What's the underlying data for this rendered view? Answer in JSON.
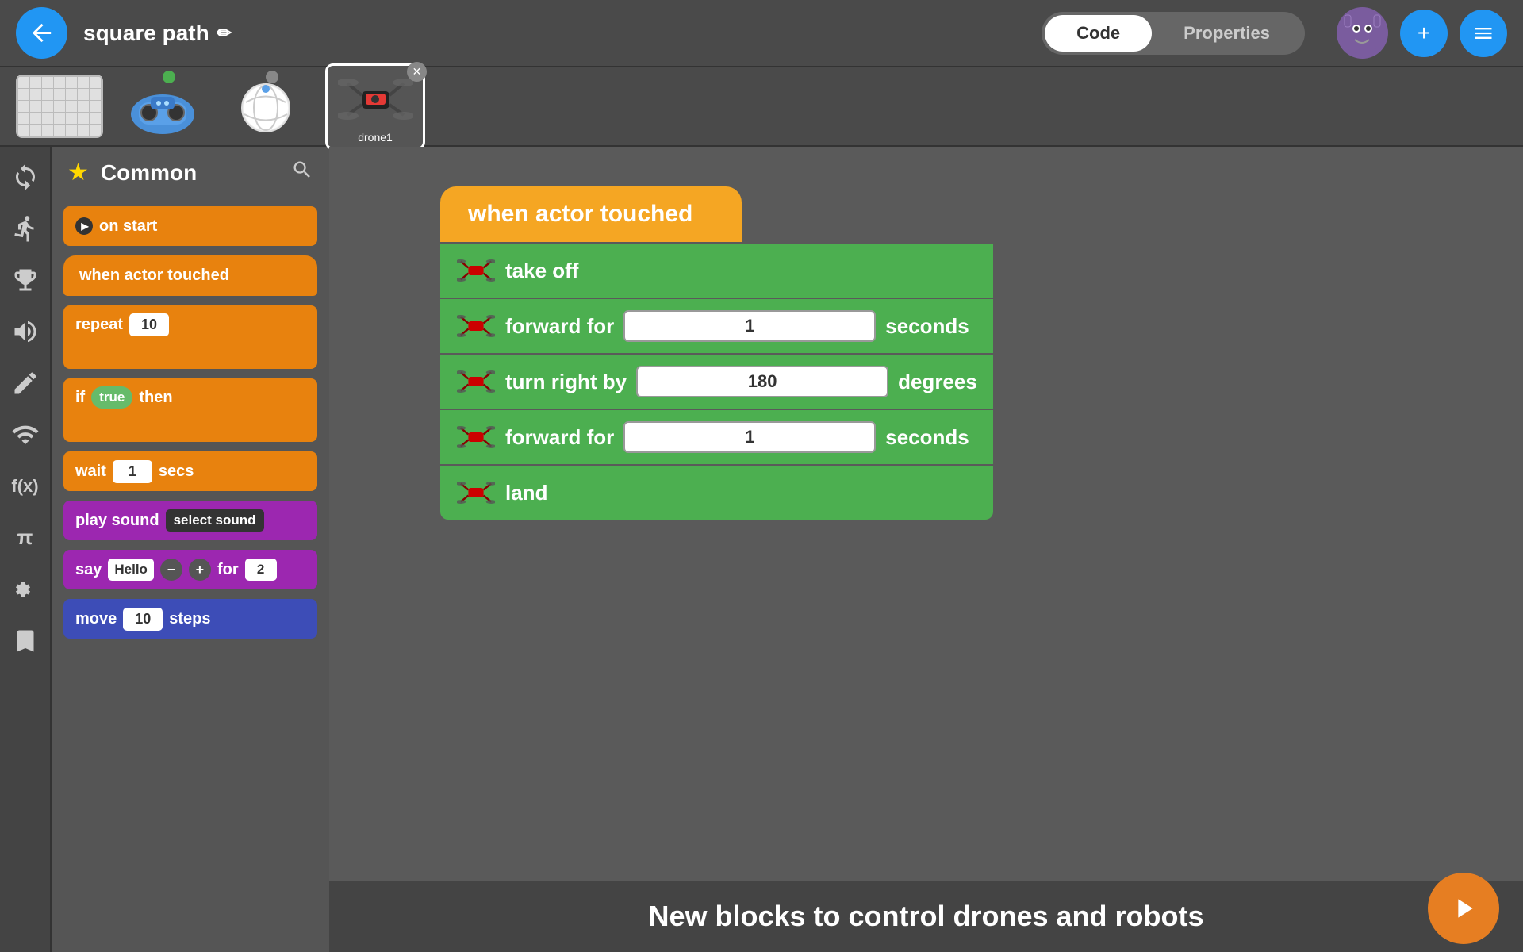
{
  "topbar": {
    "back_label": "←",
    "project_title": "square path",
    "pencil": "✏",
    "tab_code": "Code",
    "tab_properties": "Properties"
  },
  "devices": [
    {
      "id": "grid",
      "type": "grid",
      "label": ""
    },
    {
      "id": "robot",
      "type": "robot",
      "indicator": "green"
    },
    {
      "id": "ball",
      "type": "ball",
      "indicator": "gray"
    },
    {
      "id": "drone",
      "type": "drone",
      "label": "drone1",
      "selected": true
    }
  ],
  "sidebar": {
    "category": "Common",
    "nav_icons": [
      "↩",
      "🏃",
      "🏆",
      "🔊",
      "✏",
      "((•))",
      "f(x)",
      "π",
      "⚛",
      "📎"
    ]
  },
  "blocks_panel": {
    "blocks": [
      {
        "id": "on-start",
        "color": "orange",
        "text": "on start",
        "type": "event"
      },
      {
        "id": "when-actor-touched",
        "color": "orange",
        "text": "when actor touched",
        "type": "event"
      },
      {
        "id": "repeat",
        "color": "orange",
        "text": "repeat",
        "input": "10",
        "type": "control"
      },
      {
        "id": "if-then",
        "color": "orange",
        "text": "if",
        "condition": "true",
        "suffix": "then",
        "type": "control"
      },
      {
        "id": "wait",
        "color": "orange",
        "text": "wait",
        "input": "1",
        "suffix": "secs",
        "type": "control"
      },
      {
        "id": "play-sound",
        "color": "purple",
        "text": "play sound",
        "selector": "select sound",
        "type": "sound"
      },
      {
        "id": "say",
        "color": "purple",
        "text": "say",
        "hello": "Hello",
        "minus": "−",
        "plus": "+",
        "for": "for",
        "num": "2",
        "type": "looks"
      },
      {
        "id": "move",
        "color": "blue-dark",
        "text": "move",
        "input": "10",
        "suffix": "steps",
        "type": "motion"
      }
    ]
  },
  "canvas": {
    "trigger": "when actor touched",
    "blocks": [
      {
        "id": "take-off",
        "color": "green",
        "text": "take off",
        "has_drone": true
      },
      {
        "id": "forward1",
        "color": "green",
        "text": "forward for",
        "input": "1",
        "suffix": "seconds",
        "has_drone": true
      },
      {
        "id": "turn-right",
        "color": "green",
        "text": "turn right by",
        "input": "180",
        "suffix": "degrees",
        "has_drone": true
      },
      {
        "id": "forward2",
        "color": "green",
        "text": "forward for",
        "input": "1",
        "suffix": "seconds",
        "has_drone": true
      },
      {
        "id": "land",
        "color": "green",
        "text": "land",
        "has_drone": true
      }
    ]
  },
  "bottom": {
    "message": "New blocks to control drones and robots",
    "play_label": "▶"
  }
}
